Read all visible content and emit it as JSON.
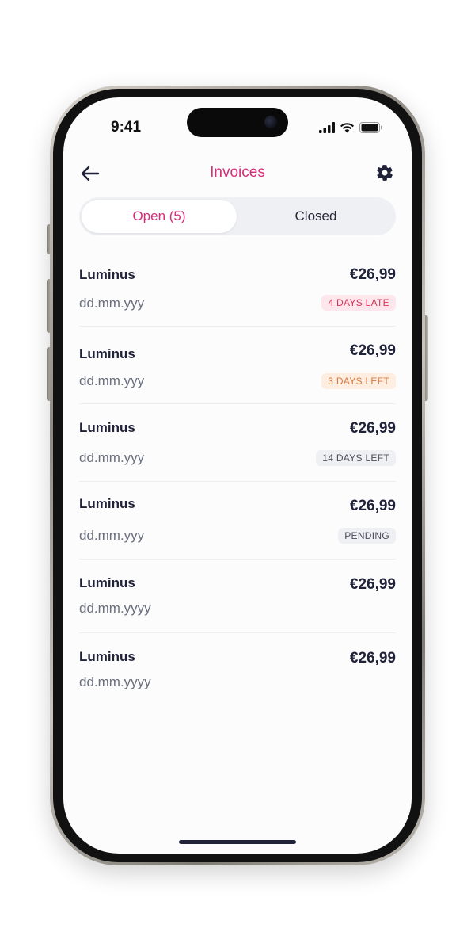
{
  "status_bar": {
    "time": "9:41",
    "signal_icon": "cellular-signal-icon",
    "wifi_icon": "wifi-icon",
    "battery_icon": "battery-icon"
  },
  "nav": {
    "title": "Invoices",
    "back_icon": "arrow-left-icon",
    "settings_icon": "gear-icon"
  },
  "tabs": [
    {
      "label": "Open (5)",
      "active": true
    },
    {
      "label": "Closed",
      "active": false
    }
  ],
  "colors": {
    "accent": "#d62f7a",
    "text_primary": "#1f2238",
    "text_secondary": "#6b6f7d",
    "late_bg": "#fde7ec",
    "late_fg": "#d63357",
    "soon_bg": "#fdeee1",
    "soon_fg": "#d9783e",
    "neutral_bg": "#eef0f3",
    "neutral_fg": "#4a4e5c"
  },
  "invoices": [
    {
      "name": "Luminus",
      "amount": "€26,99",
      "date": "dd.mm.yyy",
      "badge": "4 DAYS LATE",
      "badge_type": "late"
    },
    {
      "name": "Luminus",
      "amount": "€26,99",
      "date": "dd.mm.yyy",
      "badge": "3 DAYS LEFT",
      "badge_type": "soon"
    },
    {
      "name": "Luminus",
      "amount": "€26,99",
      "date": "dd.mm.yyy",
      "badge": "14 DAYS LEFT",
      "badge_type": "neutral"
    },
    {
      "name": "Luminus",
      "amount": "€26,99",
      "date": "dd.mm.yyy",
      "badge": "PENDING",
      "badge_type": "neutral"
    },
    {
      "name": "Luminus",
      "amount": "€26,99",
      "date": "dd.mm.yyyy",
      "badge": "",
      "badge_type": "none"
    },
    {
      "name": "Luminus",
      "amount": "€26,99",
      "date": "dd.mm.yyyy",
      "badge": "",
      "badge_type": "none"
    }
  ]
}
